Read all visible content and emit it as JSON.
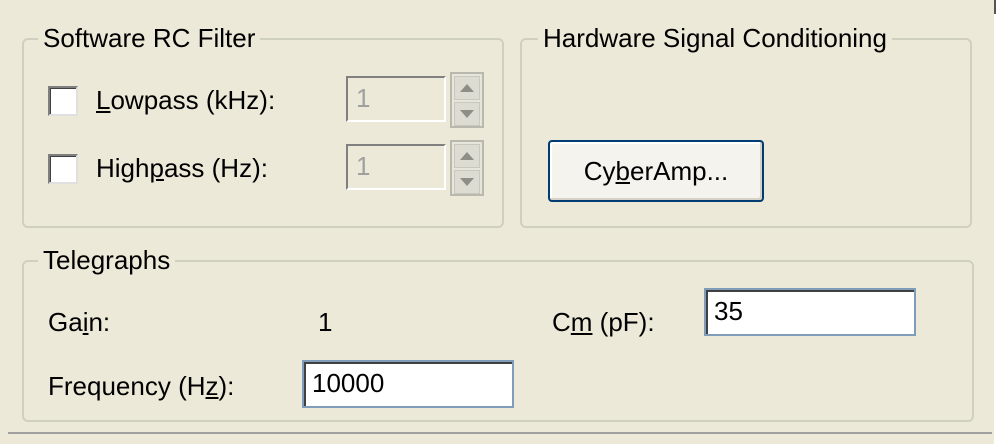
{
  "software_filter": {
    "title": "Software RC Filter",
    "lowpass": {
      "label_pre": "",
      "label_mnemonic": "L",
      "label_post": "owpass (kHz):",
      "checked": false,
      "value": "1"
    },
    "highpass": {
      "label_pre": "High",
      "label_mnemonic": "p",
      "label_post": "ass (Hz):",
      "checked": false,
      "value": "1"
    }
  },
  "hardware": {
    "title": "Hardware Signal Conditioning",
    "cyberamp_pre": "Cy",
    "cyberamp_mnemonic": "b",
    "cyberamp_post": "erAmp..."
  },
  "telegraphs": {
    "title": "Telegraphs",
    "gain_pre": "Ga",
    "gain_mnemonic": "i",
    "gain_post": "n:",
    "gain_value": "1",
    "cm_pre": "C",
    "cm_mnemonic": "m",
    "cm_post": " (pF):",
    "cm_value": "35",
    "freq_pre": "Frequency (H",
    "freq_mnemonic": "z",
    "freq_post": "):",
    "freq_value": "10000"
  }
}
